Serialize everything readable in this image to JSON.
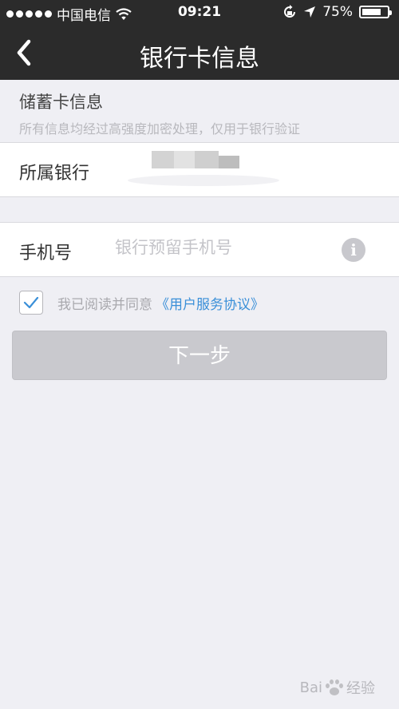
{
  "status_bar": {
    "carrier": "中国电信",
    "time": "09:21",
    "battery_text": "75%",
    "battery_level": 0.75,
    "icons": [
      "signal-dots",
      "wifi-icon",
      "rotation-lock-icon",
      "location-icon",
      "battery-icon"
    ]
  },
  "nav": {
    "title": "银行卡信息",
    "back_icon": "chevron-left-icon"
  },
  "section": {
    "title": "储蓄卡信息",
    "subtitle": "所有信息均经过高强度加密处理，仅用于银行验证"
  },
  "bank_row": {
    "label": "所属银行"
  },
  "phone_row": {
    "label": "手机号",
    "value": "",
    "placeholder": "银行预留手机号",
    "info_icon": "info-icon"
  },
  "agreement": {
    "checked": true,
    "text": "我已阅读并同意",
    "link": "《用户服务协议》"
  },
  "next_button": {
    "label": "下一步"
  },
  "watermark": {
    "text_left": "Bai",
    "text_right": "经验"
  },
  "colors": {
    "navbar": "#2b2b2b",
    "background": "#efeff4",
    "link": "#3a8fd8",
    "button_disabled": "#c9c9ce"
  }
}
